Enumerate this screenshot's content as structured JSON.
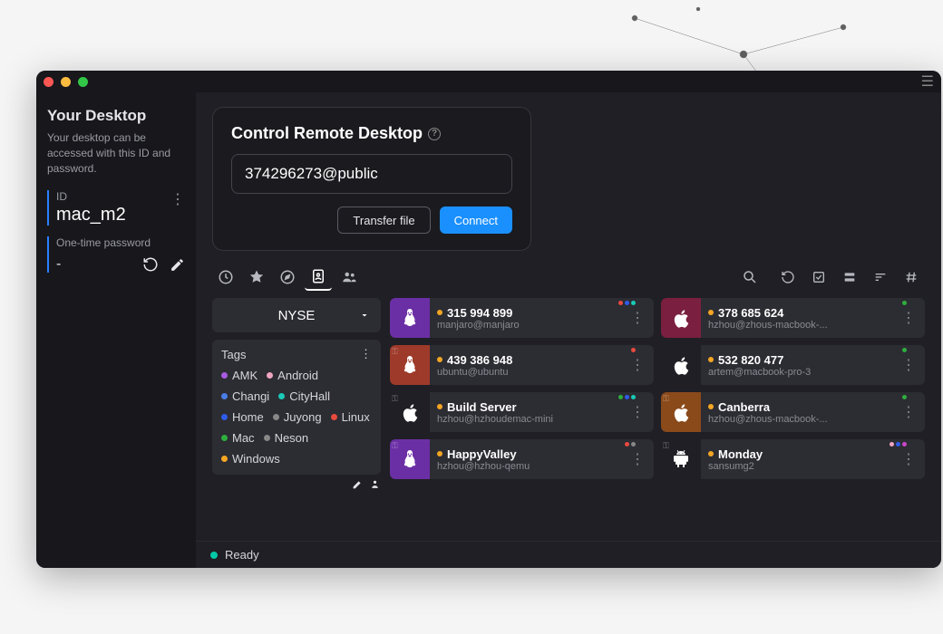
{
  "sidebar": {
    "title": "Your Desktop",
    "desc": "Your desktop can be accessed with this ID and password.",
    "id_label": "ID",
    "id_value": "mac_m2",
    "otp_label": "One-time password",
    "otp_value": "-"
  },
  "control": {
    "title": "Control Remote Desktop",
    "input_value": "374296273@public",
    "transfer_label": "Transfer file",
    "connect_label": "Connect"
  },
  "group": {
    "selected": "NYSE"
  },
  "tags": {
    "heading": "Tags",
    "items": [
      {
        "name": "AMK",
        "color": "#a85ae0"
      },
      {
        "name": "Android",
        "color": "#f0a5c0"
      },
      {
        "name": "Changi",
        "color": "#4a7de8"
      },
      {
        "name": "CityHall",
        "color": "#1ac9b7"
      },
      {
        "name": "Home",
        "color": "#2e5be8"
      },
      {
        "name": "Juyong",
        "color": "#888888"
      },
      {
        "name": "Linux",
        "color": "#e84a3d"
      },
      {
        "name": "Mac",
        "color": "#2eae3d"
      },
      {
        "name": "Neson",
        "color": "#888888"
      },
      {
        "name": "Windows",
        "color": "#f5a623"
      }
    ]
  },
  "devices": [
    {
      "id": "315 994 899",
      "host": "manjaro@manjaro",
      "os": "linux",
      "bg": "#6b2fa5",
      "tags": [
        "#e84a3d",
        "#2e5be8",
        "#1ac9b7"
      ]
    },
    {
      "id": "378 685 624",
      "host": "hzhou@zhous-macbook-...",
      "os": "apple",
      "bg": "#7a1f3f",
      "tags": [
        "#2eae3d"
      ]
    },
    {
      "id": "439 386 948",
      "host": "ubuntu@ubuntu",
      "os": "linux",
      "bg": "#9e3a2a",
      "tags": [
        "#e84a3d"
      ],
      "key": true
    },
    {
      "id": "532 820 477",
      "host": "artem@macbook-pro-3",
      "os": "apple",
      "bg": "#1f1f25",
      "tags": [
        "#2eae3d"
      ]
    },
    {
      "id": "Build Server",
      "host": "hzhou@hzhoudemac-mini",
      "os": "apple",
      "bg": "#1f1f25",
      "tags": [
        "#2eae3d",
        "#2e5be8",
        "#1ac9b7"
      ],
      "key": true
    },
    {
      "id": "Canberra",
      "host": "hzhou@zhous-macbook-...",
      "os": "apple",
      "bg": "#8a4a1a",
      "tags": [
        "#2eae3d"
      ],
      "key": true
    },
    {
      "id": "HappyValley",
      "host": "hzhou@hzhou-qemu",
      "os": "linux",
      "bg": "#6b2fa5",
      "tags": [
        "#e84a3d",
        "#888888"
      ],
      "key": true
    },
    {
      "id": "Monday",
      "host": "sansumg2",
      "os": "android",
      "bg": "#1f1f25",
      "tags": [
        "#f0a5c0",
        "#2e5be8",
        "#c947c9"
      ],
      "key": true
    }
  ],
  "status": {
    "text": "Ready"
  }
}
